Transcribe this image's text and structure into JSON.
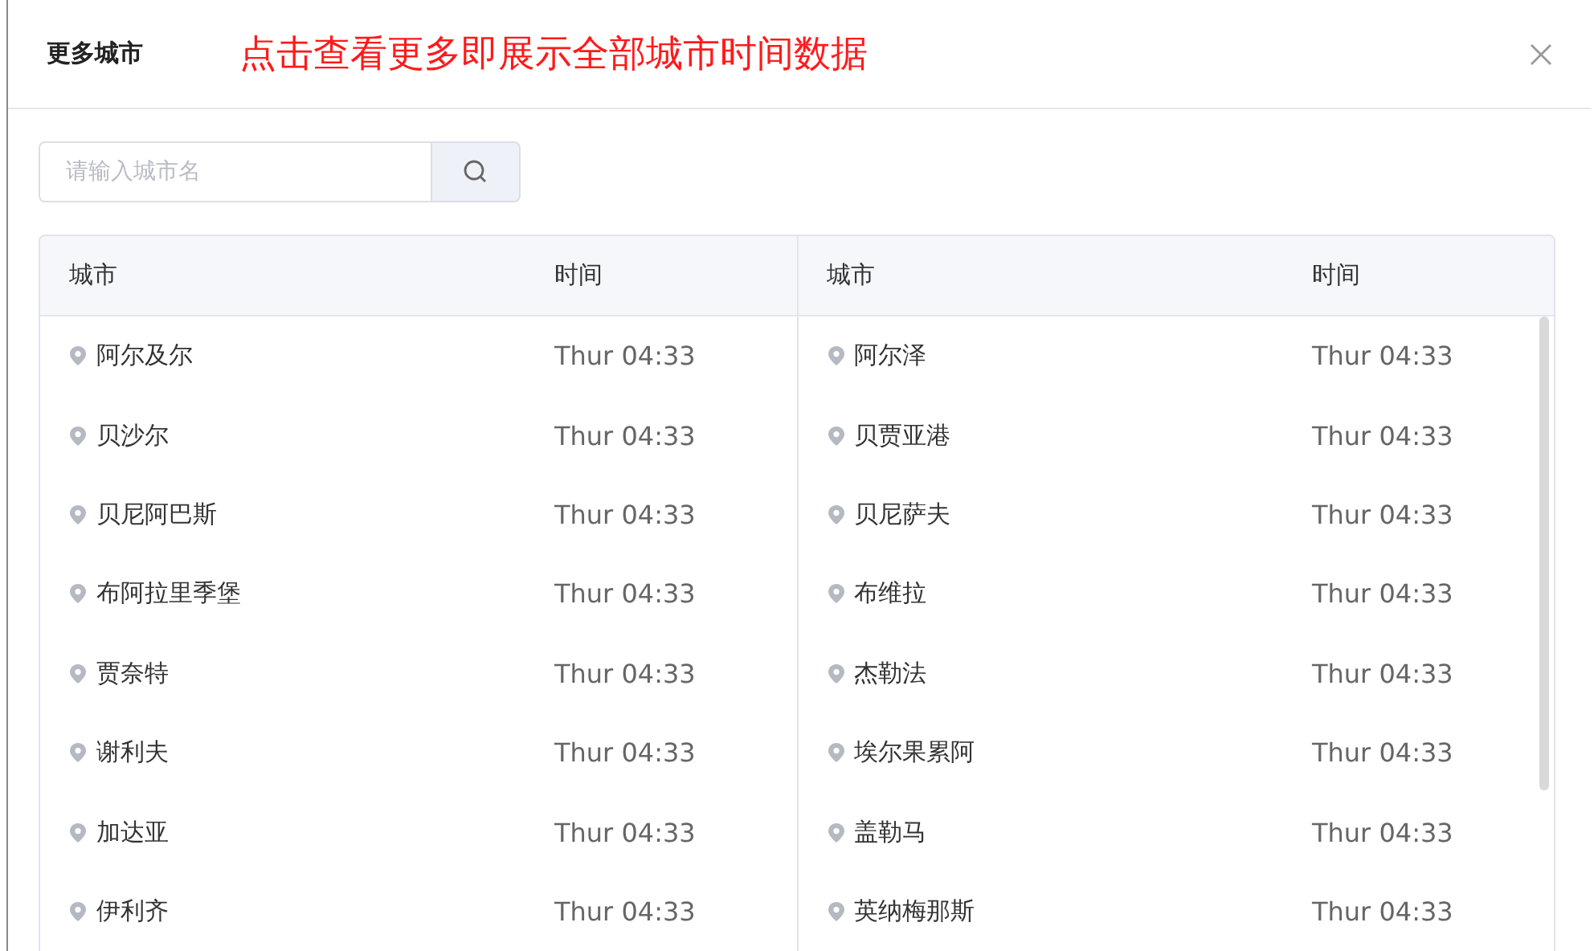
{
  "dialog": {
    "title": "更多城市",
    "annotation": "点击查看更多即展示全部城市时间数据"
  },
  "search": {
    "placeholder": "请输入城市名"
  },
  "panels": [
    {
      "columns": [
        "城市",
        "时间"
      ],
      "rows": [
        {
          "city": "阿尔及尔",
          "time": "Thur 04:33"
        },
        {
          "city": "贝沙尔",
          "time": "Thur 04:33"
        },
        {
          "city": "贝尼阿巴斯",
          "time": "Thur 04:33"
        },
        {
          "city": "布阿拉里季堡",
          "time": "Thur 04:33"
        },
        {
          "city": "贾奈特",
          "time": "Thur 04:33"
        },
        {
          "city": "谢利夫",
          "time": "Thur 04:33"
        },
        {
          "city": "加达亚",
          "time": "Thur 04:33"
        },
        {
          "city": "伊利齐",
          "time": "Thur 04:33"
        }
      ]
    },
    {
      "columns": [
        "城市",
        "时间"
      ],
      "rows": [
        {
          "city": "阿尔泽",
          "time": "Thur 04:33"
        },
        {
          "city": "贝贾亚港",
          "time": "Thur 04:33"
        },
        {
          "city": "贝尼萨夫",
          "time": "Thur 04:33"
        },
        {
          "city": "布维拉",
          "time": "Thur 04:33"
        },
        {
          "city": "杰勒法",
          "time": "Thur 04:33"
        },
        {
          "city": "埃尔果累阿",
          "time": "Thur 04:33"
        },
        {
          "city": "盖勒马",
          "time": "Thur 04:33"
        },
        {
          "city": "英纳梅那斯",
          "time": "Thur 04:33"
        }
      ]
    }
  ]
}
